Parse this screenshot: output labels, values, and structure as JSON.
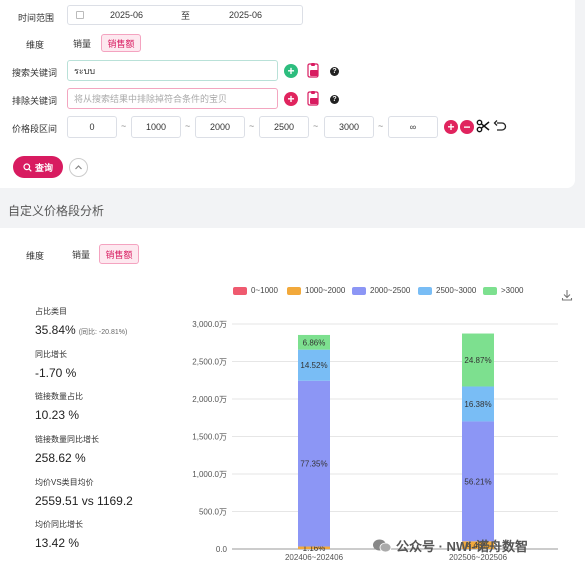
{
  "filters": {
    "time_range_label": "时间范围",
    "time_start": "2025-06",
    "time_sep": "至",
    "time_end": "2025-06",
    "dimension_label": "维度",
    "dim_options": [
      "销量",
      "销售额"
    ],
    "dim_active_index": 1,
    "search_label": "搜索关键词",
    "search_value": "ระบบ",
    "exclude_label": "排除关键词",
    "exclude_placeholder": "将从搜索结果中排除掉符合条件的宝贝",
    "price_label": "价格段区间",
    "price_points": [
      "0",
      "1000",
      "2000",
      "2500",
      "3000",
      "∞"
    ],
    "query_label": "查询",
    "collapse_icon": "chevron-up-icon",
    "search_help_icon": "question-icon",
    "icon_names": [
      "add-icon",
      "paste-icon",
      "remove-icon",
      "scissors-icon",
      "undo-icon"
    ]
  },
  "section": {
    "title": "自定义价格段分析",
    "dimension_label": "维度",
    "dim_options": [
      "销量",
      "销售额"
    ],
    "dim_active_index": 1
  },
  "stats": [
    {
      "label": "占比类目",
      "value": "35.84%",
      "sub": "(同比: -20.81%)"
    },
    {
      "label": "同比增长",
      "value": "-1.70 %",
      "sub": ""
    },
    {
      "label": "链接数量占比",
      "value": "10.23 %",
      "sub": ""
    },
    {
      "label": "链接数量同比增长",
      "value": "258.62 %",
      "sub": ""
    },
    {
      "label": "均价VS类目均价",
      "value": "2559.51 vs 1169.2",
      "sub": ""
    },
    {
      "label": "均价同比增长",
      "value": "13.42 %",
      "sub": ""
    }
  ],
  "watermark": "公众号 · NWi-诺舟数智",
  "chart_data": {
    "type": "bar",
    "stacked": true,
    "categories": [
      "202406~202406",
      "202506~202506"
    ],
    "ylim": [
      0,
      3000
    ],
    "yticks": [
      "0.0",
      "500.0万",
      "1,000.0万",
      "1,500.0万",
      "2,000.0万",
      "2,500.0万",
      "3,000.0万"
    ],
    "ytick_values": [
      0,
      500,
      1000,
      1500,
      2000,
      2500,
      3000
    ],
    "legend_position": "top",
    "grid": true,
    "series": [
      {
        "name": "0~1000",
        "color": "#ef5a6f",
        "values": [
          0,
          0
        ],
        "labels": [
          "",
          ""
        ]
      },
      {
        "name": "1000~2000",
        "color": "#f2a93b",
        "values": [
          33,
          103
        ],
        "labels": [
          "1.16%",
          "4.48%"
        ]
      },
      {
        "name": "2000~2500",
        "color": "#8c96f5",
        "values": [
          2210,
          1598
        ],
        "labels": [
          "77.35%",
          "56.21%"
        ]
      },
      {
        "name": "2500~3000",
        "color": "#79bdf5",
        "values": [
          415,
          466
        ],
        "labels": [
          "14.52%",
          "16.38%"
        ]
      },
      {
        "name": ">3000",
        "color": "#7de08f",
        "values": [
          196,
          706
        ],
        "labels": [
          "6.86%",
          "24.87%"
        ]
      }
    ],
    "download_icon": "download-icon"
  }
}
